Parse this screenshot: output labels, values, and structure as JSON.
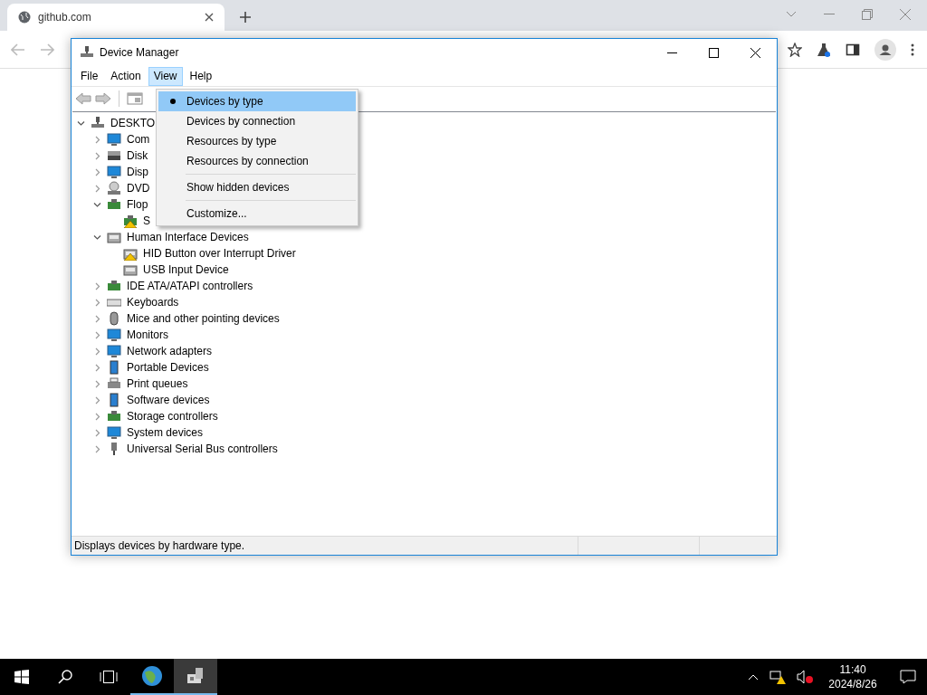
{
  "browser": {
    "tab": {
      "title": "github.com"
    }
  },
  "window": {
    "title": "Device Manager",
    "menu": [
      {
        "label": "File",
        "selected": false
      },
      {
        "label": "Action",
        "selected": false
      },
      {
        "label": "View",
        "selected": true
      },
      {
        "label": "Help",
        "selected": false
      }
    ],
    "view_menu": [
      {
        "kind": "item",
        "label": "Devices by type",
        "selected": true,
        "highlighted": true
      },
      {
        "kind": "item",
        "label": "Devices by connection",
        "selected": false,
        "highlighted": false
      },
      {
        "kind": "item",
        "label": "Resources by type",
        "selected": false,
        "highlighted": false
      },
      {
        "kind": "item",
        "label": "Resources by connection",
        "selected": false,
        "highlighted": false
      },
      {
        "kind": "separator"
      },
      {
        "kind": "item",
        "label": "Show hidden devices",
        "selected": false,
        "highlighted": false
      },
      {
        "kind": "separator"
      },
      {
        "kind": "item",
        "label": "Customize...",
        "selected": false,
        "highlighted": false
      }
    ],
    "tree": {
      "label": "DESKTO",
      "kind": "computer",
      "expanded": true,
      "children": [
        {
          "label": "Com",
          "kind": "monitor",
          "expanded": false
        },
        {
          "label": "Disk",
          "kind": "disk",
          "expanded": false
        },
        {
          "label": "Disp",
          "kind": "monitor",
          "expanded": false
        },
        {
          "label": "DVD",
          "kind": "dvd",
          "expanded": false
        },
        {
          "label": "Flop",
          "kind": "chip",
          "expanded": true,
          "children": [
            {
              "label": "S",
              "kind": "chip",
              "warning": true
            }
          ]
        },
        {
          "label": "Human Interface Devices",
          "kind": "hid",
          "expanded": true,
          "children": [
            {
              "label": "HID Button over Interrupt Driver",
              "kind": "hid",
              "warning": true
            },
            {
              "label": "USB Input Device",
              "kind": "hid",
              "warning": false
            }
          ]
        },
        {
          "label": "IDE ATA/ATAPI controllers",
          "kind": "chip",
          "expanded": false
        },
        {
          "label": "Keyboards",
          "kind": "keyboard",
          "expanded": false
        },
        {
          "label": "Mice and other pointing devices",
          "kind": "mouse",
          "expanded": false
        },
        {
          "label": "Monitors",
          "kind": "monitor",
          "expanded": false
        },
        {
          "label": "Network adapters",
          "kind": "monitor",
          "expanded": false
        },
        {
          "label": "Portable Devices",
          "kind": "portable",
          "expanded": false
        },
        {
          "label": "Print queues",
          "kind": "printer",
          "expanded": false
        },
        {
          "label": "Software devices",
          "kind": "portable",
          "expanded": false
        },
        {
          "label": "Storage controllers",
          "kind": "chip",
          "expanded": false
        },
        {
          "label": "System devices",
          "kind": "monitor",
          "expanded": false
        },
        {
          "label": "Universal Serial Bus controllers",
          "kind": "usb",
          "expanded": false
        }
      ]
    },
    "status_bar": {
      "text": "Displays devices by hardware type."
    }
  },
  "taskbar": {
    "apps": [
      {
        "kind": "browser",
        "selected": false
      },
      {
        "kind": "devices",
        "selected": true
      }
    ],
    "time": "11:40",
    "date": "2024/8/26"
  }
}
